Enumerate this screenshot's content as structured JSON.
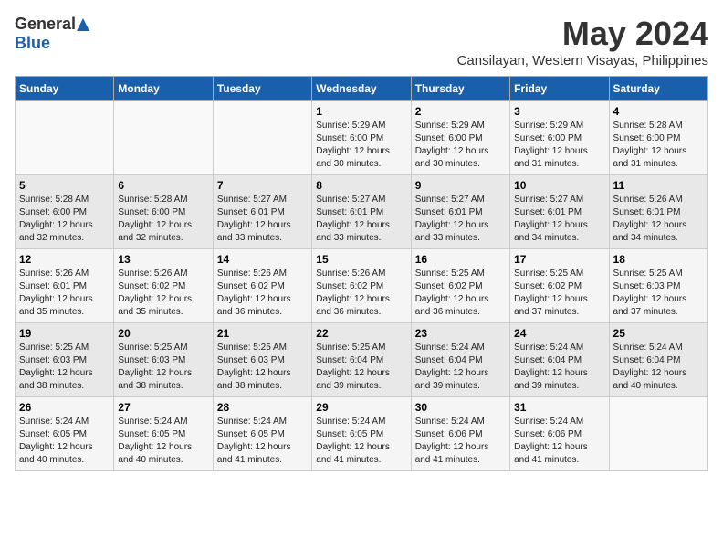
{
  "logo": {
    "general": "General",
    "blue": "Blue"
  },
  "title": {
    "month": "May 2024",
    "location": "Cansilayan, Western Visayas, Philippines"
  },
  "days_of_week": [
    "Sunday",
    "Monday",
    "Tuesday",
    "Wednesday",
    "Thursday",
    "Friday",
    "Saturday"
  ],
  "weeks": [
    [
      {
        "day": "",
        "info": ""
      },
      {
        "day": "",
        "info": ""
      },
      {
        "day": "",
        "info": ""
      },
      {
        "day": "1",
        "info": "Sunrise: 5:29 AM\nSunset: 6:00 PM\nDaylight: 12 hours\nand 30 minutes."
      },
      {
        "day": "2",
        "info": "Sunrise: 5:29 AM\nSunset: 6:00 PM\nDaylight: 12 hours\nand 30 minutes."
      },
      {
        "day": "3",
        "info": "Sunrise: 5:29 AM\nSunset: 6:00 PM\nDaylight: 12 hours\nand 31 minutes."
      },
      {
        "day": "4",
        "info": "Sunrise: 5:28 AM\nSunset: 6:00 PM\nDaylight: 12 hours\nand 31 minutes."
      }
    ],
    [
      {
        "day": "5",
        "info": "Sunrise: 5:28 AM\nSunset: 6:00 PM\nDaylight: 12 hours\nand 32 minutes."
      },
      {
        "day": "6",
        "info": "Sunrise: 5:28 AM\nSunset: 6:00 PM\nDaylight: 12 hours\nand 32 minutes."
      },
      {
        "day": "7",
        "info": "Sunrise: 5:27 AM\nSunset: 6:01 PM\nDaylight: 12 hours\nand 33 minutes."
      },
      {
        "day": "8",
        "info": "Sunrise: 5:27 AM\nSunset: 6:01 PM\nDaylight: 12 hours\nand 33 minutes."
      },
      {
        "day": "9",
        "info": "Sunrise: 5:27 AM\nSunset: 6:01 PM\nDaylight: 12 hours\nand 33 minutes."
      },
      {
        "day": "10",
        "info": "Sunrise: 5:27 AM\nSunset: 6:01 PM\nDaylight: 12 hours\nand 34 minutes."
      },
      {
        "day": "11",
        "info": "Sunrise: 5:26 AM\nSunset: 6:01 PM\nDaylight: 12 hours\nand 34 minutes."
      }
    ],
    [
      {
        "day": "12",
        "info": "Sunrise: 5:26 AM\nSunset: 6:01 PM\nDaylight: 12 hours\nand 35 minutes."
      },
      {
        "day": "13",
        "info": "Sunrise: 5:26 AM\nSunset: 6:02 PM\nDaylight: 12 hours\nand 35 minutes."
      },
      {
        "day": "14",
        "info": "Sunrise: 5:26 AM\nSunset: 6:02 PM\nDaylight: 12 hours\nand 36 minutes."
      },
      {
        "day": "15",
        "info": "Sunrise: 5:26 AM\nSunset: 6:02 PM\nDaylight: 12 hours\nand 36 minutes."
      },
      {
        "day": "16",
        "info": "Sunrise: 5:25 AM\nSunset: 6:02 PM\nDaylight: 12 hours\nand 36 minutes."
      },
      {
        "day": "17",
        "info": "Sunrise: 5:25 AM\nSunset: 6:02 PM\nDaylight: 12 hours\nand 37 minutes."
      },
      {
        "day": "18",
        "info": "Sunrise: 5:25 AM\nSunset: 6:03 PM\nDaylight: 12 hours\nand 37 minutes."
      }
    ],
    [
      {
        "day": "19",
        "info": "Sunrise: 5:25 AM\nSunset: 6:03 PM\nDaylight: 12 hours\nand 38 minutes."
      },
      {
        "day": "20",
        "info": "Sunrise: 5:25 AM\nSunset: 6:03 PM\nDaylight: 12 hours\nand 38 minutes."
      },
      {
        "day": "21",
        "info": "Sunrise: 5:25 AM\nSunset: 6:03 PM\nDaylight: 12 hours\nand 38 minutes."
      },
      {
        "day": "22",
        "info": "Sunrise: 5:25 AM\nSunset: 6:04 PM\nDaylight: 12 hours\nand 39 minutes."
      },
      {
        "day": "23",
        "info": "Sunrise: 5:24 AM\nSunset: 6:04 PM\nDaylight: 12 hours\nand 39 minutes."
      },
      {
        "day": "24",
        "info": "Sunrise: 5:24 AM\nSunset: 6:04 PM\nDaylight: 12 hours\nand 39 minutes."
      },
      {
        "day": "25",
        "info": "Sunrise: 5:24 AM\nSunset: 6:04 PM\nDaylight: 12 hours\nand 40 minutes."
      }
    ],
    [
      {
        "day": "26",
        "info": "Sunrise: 5:24 AM\nSunset: 6:05 PM\nDaylight: 12 hours\nand 40 minutes."
      },
      {
        "day": "27",
        "info": "Sunrise: 5:24 AM\nSunset: 6:05 PM\nDaylight: 12 hours\nand 40 minutes."
      },
      {
        "day": "28",
        "info": "Sunrise: 5:24 AM\nSunset: 6:05 PM\nDaylight: 12 hours\nand 41 minutes."
      },
      {
        "day": "29",
        "info": "Sunrise: 5:24 AM\nSunset: 6:05 PM\nDaylight: 12 hours\nand 41 minutes."
      },
      {
        "day": "30",
        "info": "Sunrise: 5:24 AM\nSunset: 6:06 PM\nDaylight: 12 hours\nand 41 minutes."
      },
      {
        "day": "31",
        "info": "Sunrise: 5:24 AM\nSunset: 6:06 PM\nDaylight: 12 hours\nand 41 minutes."
      },
      {
        "day": "",
        "info": ""
      }
    ]
  ]
}
